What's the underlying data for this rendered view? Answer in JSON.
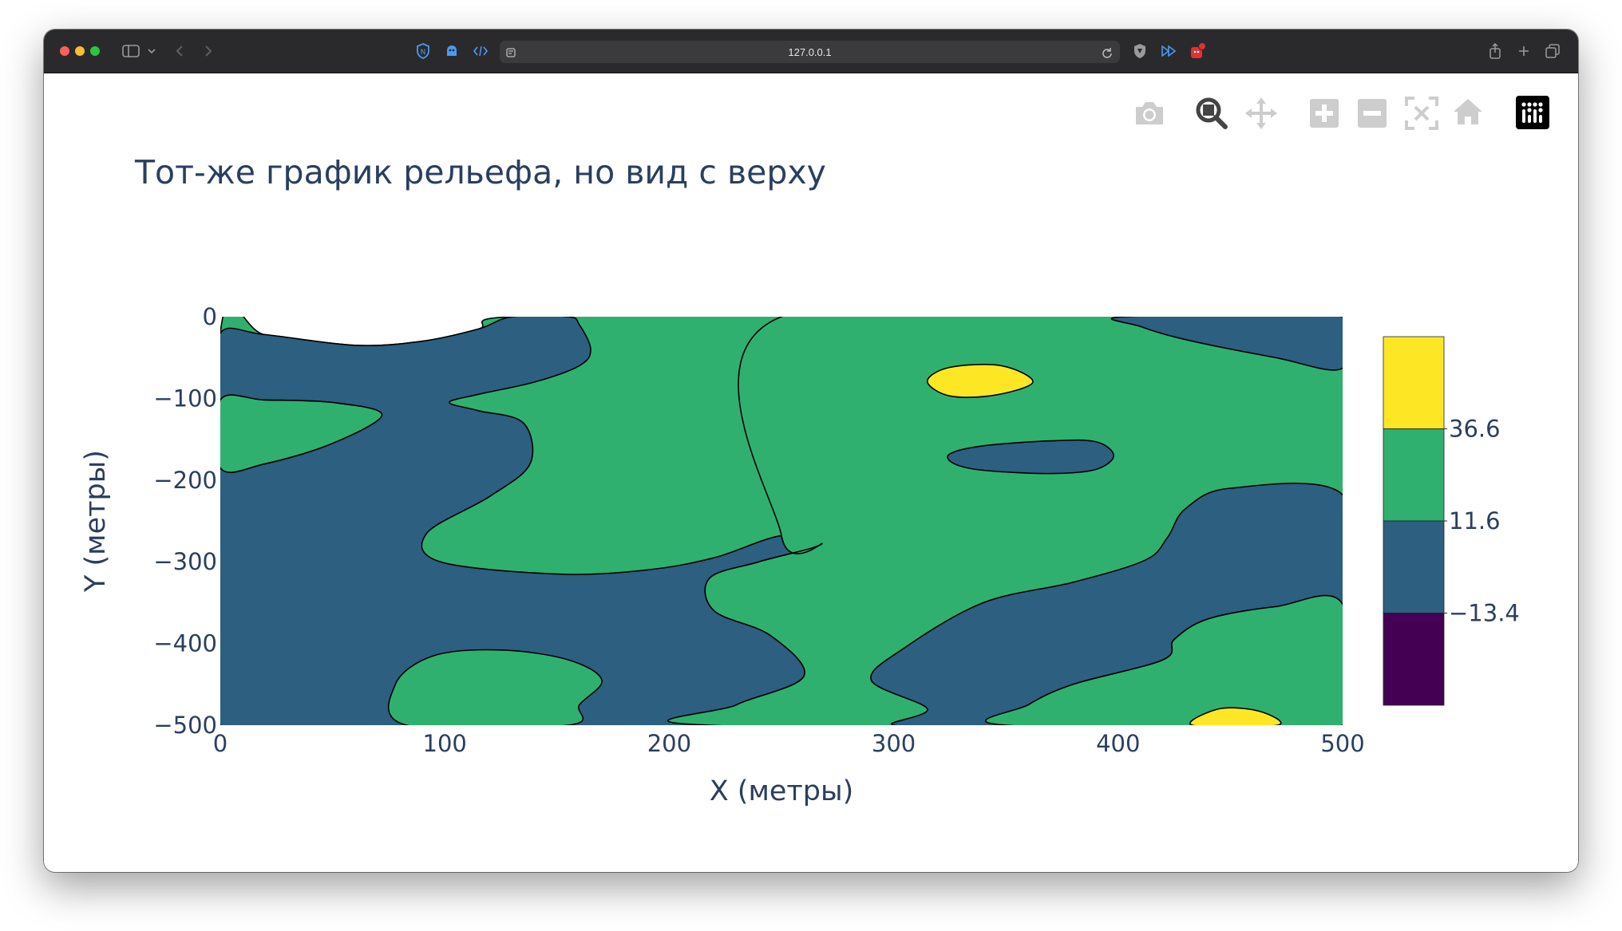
{
  "browser": {
    "address": "127.0.0.1"
  },
  "modebar": {
    "buttons": [
      "camera-icon",
      "zoom-icon",
      "pan-icon",
      "zoom-in-icon",
      "zoom-out-icon",
      "autoscale-icon",
      "reset-axes-icon",
      "plotly-logo"
    ]
  },
  "colors": {
    "yellow": "#fde725",
    "green": "#2fb06f",
    "blue": "#2c5f80",
    "purple": "#440154",
    "text": "#2a3f5f"
  },
  "chart_data": {
    "type": "contour",
    "title": "Тот-же график рельефа, но вид с верху",
    "xlabel": "X (метры)",
    "ylabel": "Y (метры)",
    "xlim": [
      0,
      500
    ],
    "ylim": [
      -500,
      0
    ],
    "xticks": [
      "0",
      "100",
      "200",
      "300",
      "400",
      "500"
    ],
    "yticks": [
      "0",
      "−100",
      "−200",
      "−300",
      "−400",
      "−500"
    ],
    "colorbar": {
      "ticks": [
        "36.6",
        "11.6",
        "−13.4"
      ],
      "levels": [
        {
          "range": [
            36.6,
            61.6
          ],
          "color": "#fde725"
        },
        {
          "range": [
            11.6,
            36.6
          ],
          "color": "#2fb06f"
        },
        {
          "range": [
            -13.4,
            11.6
          ],
          "color": "#2c5f80"
        },
        {
          "range": [
            -38.4,
            -13.4
          ],
          "color": "#440154"
        }
      ]
    },
    "regions": [
      {
        "band": "green",
        "points": [
          [
            0,
            -20
          ],
          [
            20,
            -22
          ],
          [
            60,
            -35
          ],
          [
            90,
            -30
          ],
          [
            115,
            -15
          ],
          [
            130,
            0
          ],
          [
            250,
            0
          ],
          [
            250,
            -500
          ],
          [
            0,
            -500
          ]
        ]
      },
      {
        "band": "blue",
        "points": [
          [
            0,
            -20
          ],
          [
            20,
            -22
          ],
          [
            60,
            -35
          ],
          [
            90,
            -30
          ],
          [
            115,
            -15
          ],
          [
            130,
            0
          ],
          [
            155,
            0
          ],
          [
            160,
            -10
          ],
          [
            165,
            -40
          ],
          [
            160,
            -60
          ],
          [
            140,
            -80
          ],
          [
            115,
            -95
          ],
          [
            102,
            -105
          ],
          [
            115,
            -115
          ],
          [
            135,
            -130
          ],
          [
            138,
            -180
          ],
          [
            120,
            -220
          ],
          [
            92,
            -265
          ],
          [
            98,
            -300
          ],
          [
            150,
            -315
          ],
          [
            190,
            -310
          ],
          [
            220,
            -295
          ],
          [
            250,
            -268
          ],
          [
            268,
            -278
          ],
          [
            240,
            -300
          ],
          [
            218,
            -320
          ],
          [
            220,
            -360
          ],
          [
            245,
            -390
          ],
          [
            260,
            -440
          ],
          [
            230,
            -475
          ],
          [
            218,
            -500
          ],
          [
            0,
            -500
          ],
          [
            0,
            -185
          ],
          [
            20,
            -180
          ],
          [
            50,
            -155
          ],
          [
            72,
            -120
          ],
          [
            50,
            -105
          ],
          [
            20,
            -102
          ],
          [
            0,
            -102
          ]
        ]
      },
      {
        "band": "green",
        "points": [
          [
            0,
            -102
          ],
          [
            20,
            -102
          ],
          [
            50,
            -105
          ],
          [
            72,
            -120
          ],
          [
            50,
            -155
          ],
          [
            20,
            -180
          ],
          [
            0,
            -185
          ]
        ]
      },
      {
        "band": "green",
        "points": [
          [
            83,
            -500
          ],
          [
            78,
            -450
          ],
          [
            95,
            -415
          ],
          [
            125,
            -408
          ],
          [
            155,
            -420
          ],
          [
            170,
            -445
          ],
          [
            160,
            -475
          ],
          [
            155,
            -500
          ]
        ]
      },
      {
        "band": "green",
        "points": [
          [
            250,
            -268
          ],
          [
            268,
            -278
          ],
          [
            240,
            -300
          ],
          [
            218,
            -320
          ],
          [
            220,
            -360
          ],
          [
            245,
            -390
          ],
          [
            260,
            -440
          ],
          [
            230,
            -475
          ],
          [
            218,
            -500
          ],
          [
            500,
            -500
          ],
          [
            500,
            0
          ],
          [
            250,
            0
          ]
        ]
      },
      {
        "band": "blue",
        "points": [
          [
            300,
            -500
          ],
          [
            315,
            -480
          ],
          [
            290,
            -445
          ],
          [
            305,
            -405
          ],
          [
            340,
            -350
          ],
          [
            380,
            -325
          ],
          [
            412,
            -298
          ],
          [
            422,
            -270
          ],
          [
            430,
            -235
          ],
          [
            450,
            -210
          ],
          [
            500,
            -218
          ],
          [
            500,
            -352
          ],
          [
            470,
            -355
          ],
          [
            440,
            -370
          ],
          [
            425,
            -395
          ],
          [
            420,
            -420
          ],
          [
            380,
            -450
          ],
          [
            360,
            -475
          ],
          [
            350,
            -500
          ]
        ]
      },
      {
        "band": "green",
        "points": [
          [
            350,
            -500
          ],
          [
            360,
            -475
          ],
          [
            380,
            -450
          ],
          [
            420,
            -420
          ],
          [
            425,
            -395
          ],
          [
            440,
            -370
          ],
          [
            470,
            -355
          ],
          [
            500,
            -352
          ],
          [
            500,
            -500
          ]
        ]
      },
      {
        "band": "blue",
        "points": [
          [
            403,
            0
          ],
          [
            410,
            -12
          ],
          [
            430,
            -28
          ],
          [
            470,
            -50
          ],
          [
            500,
            -63
          ],
          [
            500,
            0
          ]
        ]
      },
      {
        "band": "blue",
        "points": [
          [
            325,
            -168
          ],
          [
            340,
            -158
          ],
          [
            370,
            -152
          ],
          [
            390,
            -153
          ],
          [
            398,
            -170
          ],
          [
            390,
            -187
          ],
          [
            370,
            -192
          ],
          [
            340,
            -188
          ],
          [
            327,
            -180
          ]
        ]
      },
      {
        "band": "yellow",
        "points": [
          [
            315,
            -79
          ],
          [
            325,
            -62
          ],
          [
            348,
            -60
          ],
          [
            362,
            -80
          ],
          [
            345,
            -96
          ],
          [
            325,
            -97
          ]
        ]
      },
      {
        "band": "yellow",
        "points": [
          [
            433,
            -500
          ],
          [
            445,
            -480
          ],
          [
            463,
            -483
          ],
          [
            471,
            -500
          ]
        ]
      }
    ]
  }
}
